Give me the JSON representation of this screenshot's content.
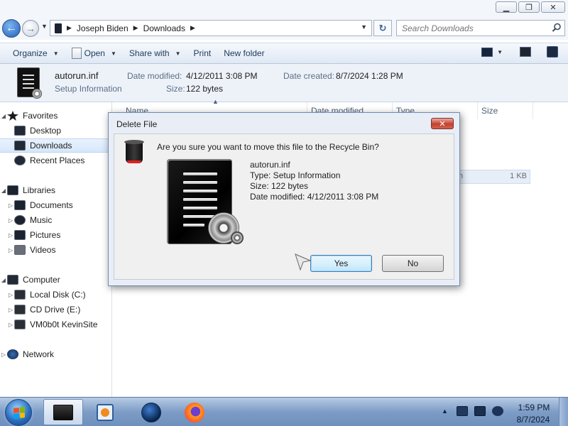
{
  "window": {
    "minimize_glyph": "▁",
    "maximize_glyph": "❐",
    "close_glyph": "✕"
  },
  "address": {
    "breadcrumbs": [
      "Joseph Biden",
      "Downloads"
    ],
    "search_placeholder": "Search Downloads"
  },
  "toolbar": {
    "organize": "Organize",
    "open": "Open",
    "share_with": "Share with",
    "print": "Print",
    "new_folder": "New folder"
  },
  "details": {
    "file_name": "autorun.inf",
    "file_type": "Setup Information",
    "date_modified_label": "Date modified:",
    "date_modified": "4/12/2011 3:08 PM",
    "date_created_label": "Date created:",
    "date_created": "8/7/2024 1:28 PM",
    "size_label": "Size:",
    "size": "122 bytes"
  },
  "navigation": {
    "favorites": "Favorites",
    "desktop": "Desktop",
    "downloads": "Downloads",
    "recent_places": "Recent Places",
    "libraries": "Libraries",
    "documents": "Documents",
    "music": "Music",
    "pictures": "Pictures",
    "videos": "Videos",
    "computer": "Computer",
    "local_disk": "Local Disk (C:)",
    "cd_drive": "CD Drive (E:)",
    "network_share": "VM0b0t KevinSite",
    "network": "Network"
  },
  "file_list": {
    "columns": [
      "Name",
      "Date modified",
      "Type",
      "Size"
    ],
    "row_tail": "n",
    "row_size": "1 KB"
  },
  "dialog": {
    "title": "Delete File",
    "close_glyph": "✕",
    "question": "Are you sure you want to move this file to the Recycle Bin?",
    "file_name": "autorun.inf",
    "file_type": "Type: Setup Information",
    "file_size": "Size: 122 bytes",
    "file_date": "Date modified: 4/12/2011 3:08 PM",
    "yes_label": "Yes",
    "no_label": "No"
  },
  "taskbar": {
    "time": "1:59 PM",
    "date": "8/7/2024",
    "tray_arrow": "▲"
  },
  "colors": {
    "accent": "#1f5fb8",
    "dialog_close": "#c4412f",
    "default_button": "#3c7fb1"
  }
}
